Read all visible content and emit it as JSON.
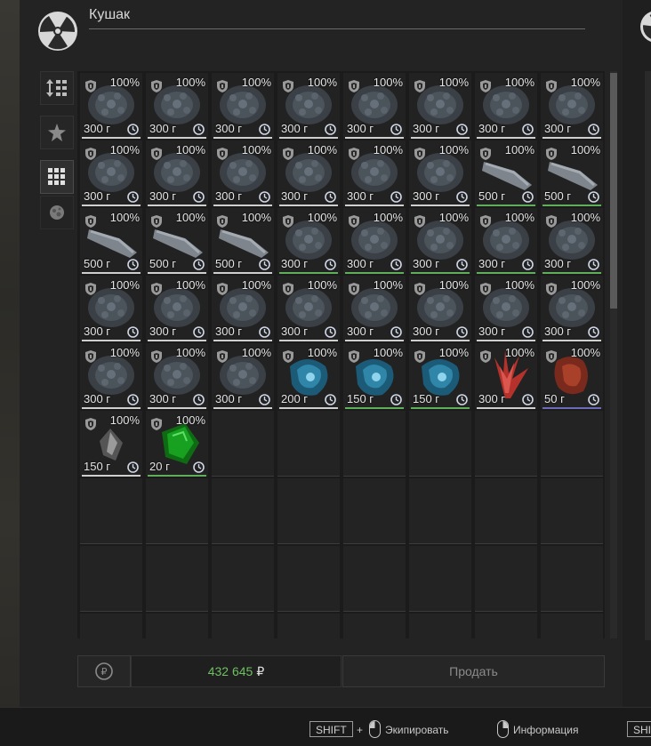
{
  "header": {
    "title": "Кушак"
  },
  "sidebar": [
    {
      "name": "sort-button-icon"
    },
    {
      "name": "favorite-star-icon"
    },
    {
      "name": "grid-view-icon"
    },
    {
      "name": "artifact-filter-icon"
    }
  ],
  "grid": {
    "columns": 8,
    "items": [
      {
        "pct": "100%",
        "weight": "300 г",
        "art": "dark-burr",
        "line": "white"
      },
      {
        "pct": "100%",
        "weight": "300 г",
        "art": "dark-burr",
        "line": "white"
      },
      {
        "pct": "100%",
        "weight": "300 г",
        "art": "dark-burr",
        "line": "white"
      },
      {
        "pct": "100%",
        "weight": "300 г",
        "art": "dark-burr",
        "line": "white"
      },
      {
        "pct": "100%",
        "weight": "300 г",
        "art": "dark-burr",
        "line": "white"
      },
      {
        "pct": "100%",
        "weight": "300 г",
        "art": "dark-burr",
        "line": "white"
      },
      {
        "pct": "100%",
        "weight": "300 г",
        "art": "dark-burr",
        "line": "white"
      },
      {
        "pct": "100%",
        "weight": "300 г",
        "art": "dark-burr",
        "line": "white"
      },
      {
        "pct": "100%",
        "weight": "300 г",
        "art": "dark-burr",
        "line": "white"
      },
      {
        "pct": "100%",
        "weight": "300 г",
        "art": "dark-burr",
        "line": "white"
      },
      {
        "pct": "100%",
        "weight": "300 г",
        "art": "dark-burr",
        "line": "white"
      },
      {
        "pct": "100%",
        "weight": "300 г",
        "art": "dark-burr",
        "line": "white"
      },
      {
        "pct": "100%",
        "weight": "300 г",
        "art": "dark-burr",
        "line": "white"
      },
      {
        "pct": "100%",
        "weight": "300 г",
        "art": "dark-burr",
        "line": "white"
      },
      {
        "pct": "100%",
        "weight": "500 г",
        "art": "gray-slab",
        "line": "green"
      },
      {
        "pct": "100%",
        "weight": "500 г",
        "art": "gray-slab",
        "line": "green"
      },
      {
        "pct": "100%",
        "weight": "500 г",
        "art": "gray-slab",
        "line": "white"
      },
      {
        "pct": "100%",
        "weight": "500 г",
        "art": "gray-slab",
        "line": "white"
      },
      {
        "pct": "100%",
        "weight": "500 г",
        "art": "gray-slab",
        "line": "white"
      },
      {
        "pct": "100%",
        "weight": "300 г",
        "art": "dark-burr",
        "line": "green"
      },
      {
        "pct": "100%",
        "weight": "300 г",
        "art": "dark-burr",
        "line": "green"
      },
      {
        "pct": "100%",
        "weight": "300 г",
        "art": "dark-burr",
        "line": "green"
      },
      {
        "pct": "100%",
        "weight": "300 г",
        "art": "dark-burr",
        "line": "green"
      },
      {
        "pct": "100%",
        "weight": "300 г",
        "art": "dark-burr",
        "line": "green"
      },
      {
        "pct": "100%",
        "weight": "300 г",
        "art": "dark-burr",
        "line": "white"
      },
      {
        "pct": "100%",
        "weight": "300 г",
        "art": "dark-burr",
        "line": "white"
      },
      {
        "pct": "100%",
        "weight": "300 г",
        "art": "dark-burr",
        "line": "white"
      },
      {
        "pct": "100%",
        "weight": "300 г",
        "art": "dark-burr",
        "line": "white"
      },
      {
        "pct": "100%",
        "weight": "300 г",
        "art": "dark-burr",
        "line": "white"
      },
      {
        "pct": "100%",
        "weight": "300 г",
        "art": "dark-burr",
        "line": "white"
      },
      {
        "pct": "100%",
        "weight": "300 г",
        "art": "dark-burr",
        "line": "white"
      },
      {
        "pct": "100%",
        "weight": "300 г",
        "art": "dark-burr",
        "line": "white"
      },
      {
        "pct": "100%",
        "weight": "300 г",
        "art": "dark-burr",
        "line": "white"
      },
      {
        "pct": "100%",
        "weight": "300 г",
        "art": "dark-burr",
        "line": "white"
      },
      {
        "pct": "100%",
        "weight": "300 г",
        "art": "dark-burr",
        "line": "white"
      },
      {
        "pct": "100%",
        "weight": "200 г",
        "art": "blue-crystal",
        "line": "white"
      },
      {
        "pct": "100%",
        "weight": "150 г",
        "art": "blue-crystal",
        "line": "green"
      },
      {
        "pct": "100%",
        "weight": "150 г",
        "art": "blue-crystal",
        "line": "green"
      },
      {
        "pct": "100%",
        "weight": "300 г",
        "art": "red-spikes",
        "line": "white"
      },
      {
        "pct": "100%",
        "weight": "50 г",
        "art": "red-rock",
        "line": "blue"
      },
      {
        "pct": "100%",
        "weight": "150 г",
        "art": "white-shard",
        "line": "white"
      },
      {
        "pct": "100%",
        "weight": "20 г",
        "art": "green-gem",
        "line": "green"
      }
    ]
  },
  "bottom": {
    "money": "432 645",
    "currency": "₽",
    "sell_label": "Продать"
  },
  "footer": {
    "shift_key": "SHIFT",
    "plus": "+",
    "equip_label": "Экипировать",
    "info_label": "Информация",
    "shift_key_2": "SHI"
  },
  "colors": {
    "accent_green": "#6fbf63",
    "line_white": "#cfcfcf",
    "line_green": "#5fae5a",
    "line_blue": "#6b6bb8"
  }
}
